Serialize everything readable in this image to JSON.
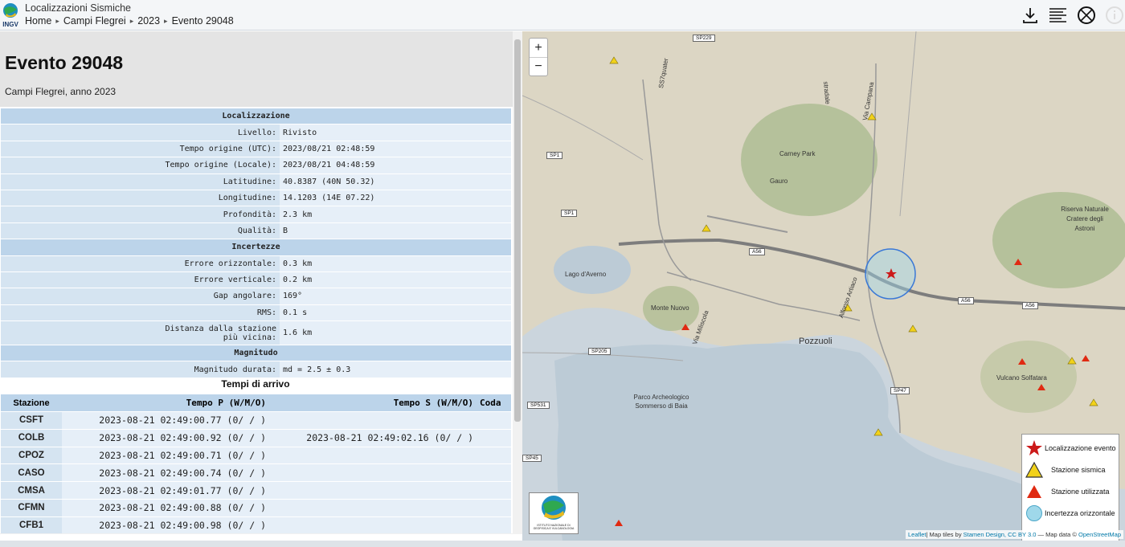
{
  "header": {
    "app_title": "Localizzazioni Sismiche",
    "breadcrumb": [
      "Home",
      "Campi Flegrei",
      "2023",
      "Evento 29048"
    ]
  },
  "event": {
    "title": "Evento 29048",
    "subtitle": "Campi Flegrei, anno 2023"
  },
  "info": {
    "localizzazione": "Localizzazione",
    "rows1": [
      {
        "k": "Livello:",
        "v": "Rivisto"
      },
      {
        "k": "Tempo origine (UTC):",
        "v": "2023/08/21 02:48:59"
      },
      {
        "k": "Tempo origine (Locale):",
        "v": "2023/08/21 04:48:59"
      },
      {
        "k": "Latitudine:",
        "v": "40.8387 (40N 50.32)"
      },
      {
        "k": "Longitudine:",
        "v": "14.1203 (14E 07.22)"
      },
      {
        "k": "Profondità:",
        "v": "2.3 km"
      },
      {
        "k": "Qualità:",
        "v": "B"
      }
    ],
    "incertezze": "Incertezze",
    "rows2": [
      {
        "k": "Errore orizzontale:",
        "v": "0.3 km"
      },
      {
        "k": "Errore verticale:",
        "v": "0.2 km"
      },
      {
        "k": "Gap angolare:",
        "v": "169°"
      },
      {
        "k": "RMS:",
        "v": "0.1 s"
      }
    ],
    "distanza_k1": "Distanza dalla stazione",
    "distanza_k2": "più vicina:",
    "distanza_v": "1.6 km",
    "magnitudo": "Magnitudo",
    "mag_k": "Magnitudo durata:",
    "mag_v": "md = 2.5 ± 0.3"
  },
  "arrivals": {
    "title": "Tempi di arrivo",
    "headers": [
      "Stazione",
      "Tempo P (W/M/O)",
      "Tempo S (W/M/O)",
      "Coda"
    ],
    "rows": [
      {
        "st": "CSFT",
        "p": "2023-08-21 02:49:00.77 (0/ / )",
        "s": "",
        "coda": ""
      },
      {
        "st": "COLB",
        "p": "2023-08-21 02:49:00.92 (0/ / )",
        "s": "2023-08-21 02:49:02.16 (0/ / )",
        "coda": ""
      },
      {
        "st": "CPOZ",
        "p": "2023-08-21 02:49:00.71 (0/ / )",
        "s": "",
        "coda": ""
      },
      {
        "st": "CASO",
        "p": "2023-08-21 02:49:00.74 (0/ / )",
        "s": "",
        "coda": ""
      },
      {
        "st": "CMSA",
        "p": "2023-08-21 02:49:01.77 (0/ / )",
        "s": "",
        "coda": ""
      },
      {
        "st": "CFMN",
        "p": "2023-08-21 02:49:00.88 (0/ / )",
        "s": "",
        "coda": ""
      },
      {
        "st": "CFB1",
        "p": "2023-08-21 02:49:00.98 (0/ / )",
        "s": "",
        "coda": ""
      }
    ]
  },
  "map": {
    "zoom_in": "+",
    "zoom_out": "−",
    "legend": [
      "Localizzazione evento",
      "Stazione sismica",
      "Stazione utilizzata",
      "Incertezza orizzontale"
    ],
    "attribution_leaflet": "Leaflet",
    "attribution_text": "| Map tiles by ",
    "attribution_stamen": "Stamen Design, CC BY 3.0",
    "attribution_mid": " — Map data © ",
    "attribution_osm": "OpenStreetMap",
    "institute": "ISTITUTO NAZIONALE DI GEOFISICA E VULCANOLOGIA",
    "labels": {
      "pozzuoli": "Pozzuoli",
      "lago": "Lago d'Averno",
      "monte_nuovo": "Monte Nuovo",
      "gauro": "Gauro",
      "carney": "Carney Park",
      "astroni": "Riserva Naturale Cratere degli Astroni",
      "solfatara": "Vulcano Solfatara",
      "parco": "Parco Archeologico Sommerso di Baia",
      "via_campana": "Via Campana",
      "via_miliscola": "Via Miliscola",
      "alfonso": "Alfonso Artiaco",
      "strada": "stradale",
      "quater": "SS7quater"
    },
    "roads": [
      "SP229",
      "SP1",
      "SP1",
      "A56",
      "A56",
      "A56",
      "SP205",
      "SP47",
      "SP531",
      "SP45"
    ],
    "colors": {
      "event": "#cc1a1a",
      "station": "#f2d21a",
      "used": "#e02a12",
      "uncertainty": "#9fd8ea"
    }
  }
}
